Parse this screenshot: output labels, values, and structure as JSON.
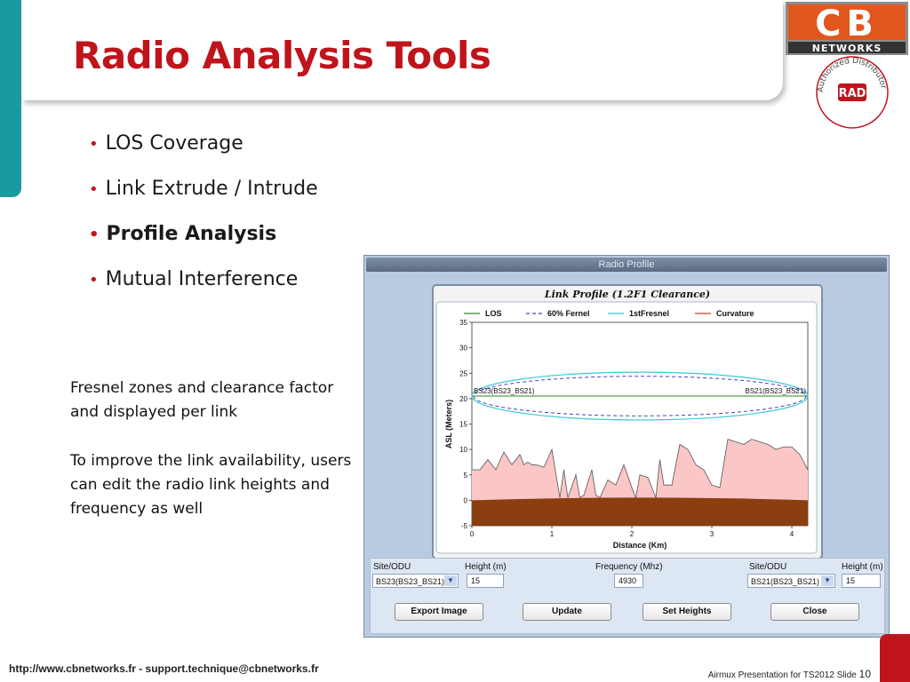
{
  "slide": {
    "title": "Radio Analysis Tools",
    "bullets": [
      {
        "text": "LOS Coverage",
        "bold": false
      },
      {
        "text": "Link Extrude / Intrude",
        "bold": false
      },
      {
        "text": "Profile Analysis",
        "bold": true
      },
      {
        "text": "Mutual Interference",
        "bold": false
      }
    ],
    "note_1": "Fresnel zones and clearance factor and displayed per link",
    "note_2": "To improve the link availability, users can edit the radio link heights and frequency as well",
    "footer_left": "http://www.cbnetworks.fr - support.technique@cbnetworks.fr",
    "footer_right": "Airmux Presentation for TS2012 Slide",
    "slide_number": "10"
  },
  "logos": {
    "cb_letters": "CB",
    "cb_networks": "NETWORKS",
    "seal_text": "Authorized Distributor",
    "seal_badge": "RAD",
    "brand_red": "#c0141c",
    "accent_teal": "#1a9aa0"
  },
  "radio_profile": {
    "window_title": "Radio Profile",
    "controls": {
      "site_label_left": "Site/ODU",
      "height_label_left": "Height (m)",
      "frequency_label": "Frequency (Mhz)",
      "site_label_right": "Site/ODU",
      "height_label_right": "Height (m)",
      "site_left_value": "BS23(BS23_BS21)",
      "height_left_value": "15",
      "frequency_value": "4930",
      "site_right_value": "BS21(BS23_BS21)",
      "height_right_value": "15",
      "buttons": [
        "Export Image",
        "Update",
        "Set Heights",
        "Close"
      ]
    }
  },
  "chart_data": {
    "type": "line",
    "title": "Link Profile (1.2F1 Clearance)",
    "xlabel": "Distance (Km)",
    "ylabel": "ASL (Meters)",
    "xlim": [
      0,
      4.2
    ],
    "ylim": [
      -5,
      35
    ],
    "xticks": [
      0,
      1,
      2,
      3,
      4
    ],
    "yticks": [
      -5,
      0,
      5,
      10,
      15,
      20,
      25,
      30,
      35
    ],
    "legend": [
      "LOS",
      "60% Fernel",
      "1stFresnel",
      "Curvature"
    ],
    "legend_position": "top",
    "grid": false,
    "colors": {
      "los": "#2e8b2e",
      "fresnel60": "#4444cc",
      "fresnel1": "#3cc8d2",
      "curvature": "#c04040",
      "terrain": "#fbc6c6",
      "earth": "#8b3e10"
    },
    "site_labels": {
      "left": "BS23(BS23_BS21)",
      "right": "BS21(BS23_BS21)"
    },
    "los_height": 20.5,
    "fresnel1_radius": 4.7,
    "fresnel60_radius": 3.9,
    "earth_top": 0,
    "earth_bottom": -5,
    "terrain": {
      "x": [
        0,
        0.1,
        0.2,
        0.3,
        0.4,
        0.5,
        0.6,
        0.65,
        0.7,
        0.75,
        0.8,
        0.9,
        1.0,
        1.1,
        1.15,
        1.2,
        1.3,
        1.35,
        1.4,
        1.5,
        1.55,
        1.6,
        1.7,
        1.8,
        1.9,
        2.0,
        2.05,
        2.1,
        2.2,
        2.3,
        2.35,
        2.4,
        2.5,
        2.6,
        2.7,
        2.8,
        2.9,
        3.0,
        3.1,
        3.2,
        3.3,
        3.4,
        3.5,
        3.6,
        3.7,
        3.8,
        3.9,
        4.0,
        4.1,
        4.2
      ],
      "y": [
        6,
        6,
        8,
        6,
        9.5,
        7,
        9,
        7,
        7.5,
        7,
        7,
        6.5,
        10,
        0.5,
        6,
        0.5,
        5,
        0.5,
        1,
        6,
        1,
        0.5,
        4,
        3,
        7,
        2.5,
        0.5,
        5,
        4.5,
        0.5,
        8,
        3,
        3,
        11,
        10,
        7,
        6,
        3,
        2.5,
        12,
        11.5,
        11,
        12,
        11.5,
        11,
        10,
        10.5,
        10.5,
        9,
        6
      ]
    }
  }
}
